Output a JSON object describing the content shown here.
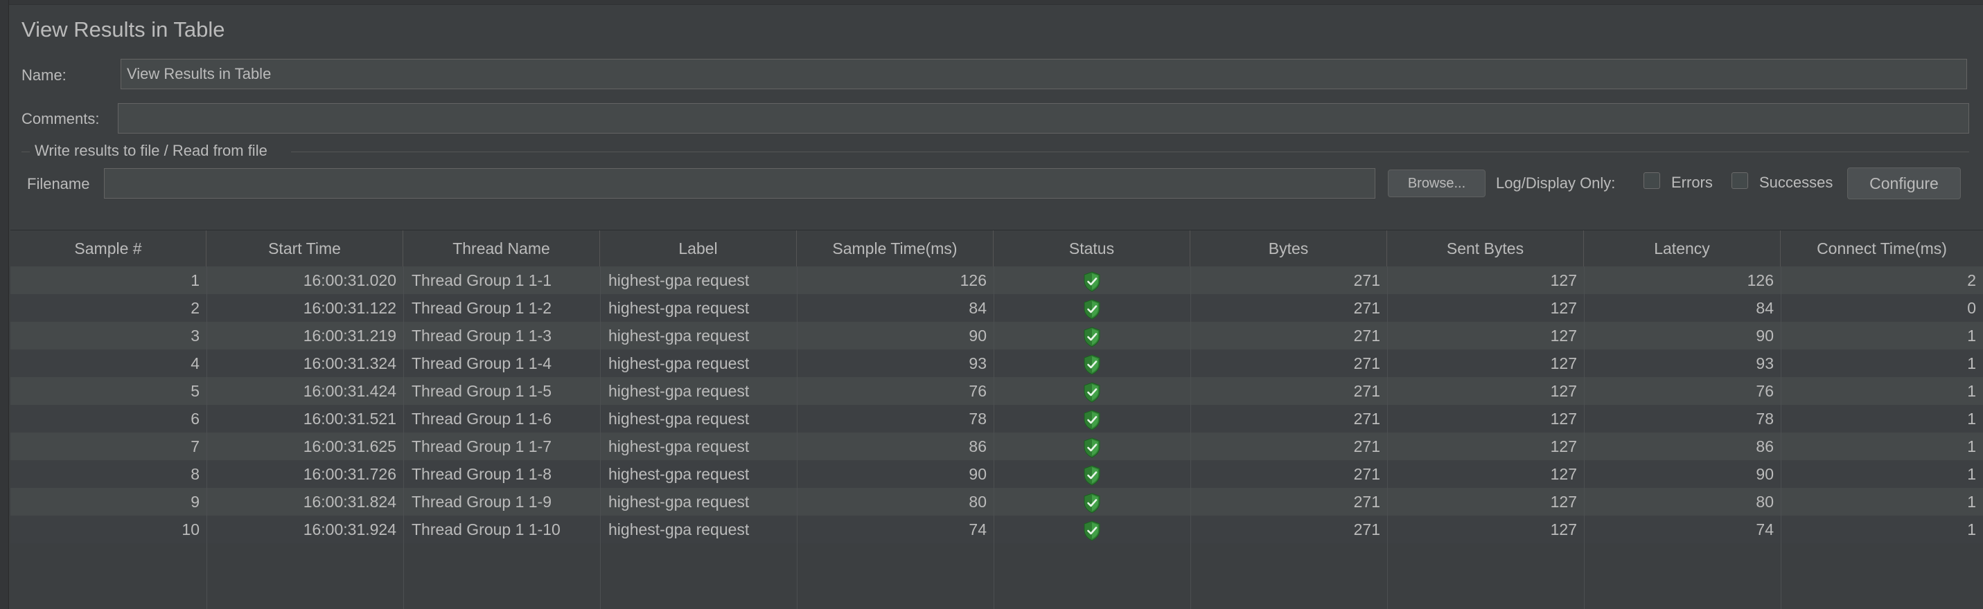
{
  "window": {
    "title": "View Results in Table"
  },
  "form": {
    "name_label": "Name:",
    "name_value": "View Results in Table",
    "comments_label": "Comments:",
    "comments_value": "",
    "file_group_title": "Write results to file / Read from file",
    "filename_label": "Filename",
    "filename_value": "",
    "browse_label": "Browse...",
    "log_display_label": "Log/Display Only:",
    "errors_label": "Errors",
    "errors_checked": false,
    "successes_label": "Successes",
    "successes_checked": false,
    "configure_label": "Configure"
  },
  "table": {
    "columns": [
      "Sample #",
      "Start Time",
      "Thread Name",
      "Label",
      "Sample Time(ms)",
      "Status",
      "Bytes",
      "Sent Bytes",
      "Latency",
      "Connect Time(ms)"
    ],
    "rows": [
      {
        "sample": "1",
        "start": "16:00:31.020",
        "thread": "Thread Group 1 1-1",
        "label": "highest-gpa request",
        "sample_time": "126",
        "status": "success-shield-icon",
        "bytes": "271",
        "sent": "127",
        "latency": "126",
        "connect": "2"
      },
      {
        "sample": "2",
        "start": "16:00:31.122",
        "thread": "Thread Group 1 1-2",
        "label": "highest-gpa request",
        "sample_time": "84",
        "status": "success-shield-icon",
        "bytes": "271",
        "sent": "127",
        "latency": "84",
        "connect": "0"
      },
      {
        "sample": "3",
        "start": "16:00:31.219",
        "thread": "Thread Group 1 1-3",
        "label": "highest-gpa request",
        "sample_time": "90",
        "status": "success-shield-icon",
        "bytes": "271",
        "sent": "127",
        "latency": "90",
        "connect": "1"
      },
      {
        "sample": "4",
        "start": "16:00:31.324",
        "thread": "Thread Group 1 1-4",
        "label": "highest-gpa request",
        "sample_time": "93",
        "status": "success-shield-icon",
        "bytes": "271",
        "sent": "127",
        "latency": "93",
        "connect": "1"
      },
      {
        "sample": "5",
        "start": "16:00:31.424",
        "thread": "Thread Group 1 1-5",
        "label": "highest-gpa request",
        "sample_time": "76",
        "status": "success-shield-icon",
        "bytes": "271",
        "sent": "127",
        "latency": "76",
        "connect": "1"
      },
      {
        "sample": "6",
        "start": "16:00:31.521",
        "thread": "Thread Group 1 1-6",
        "label": "highest-gpa request",
        "sample_time": "78",
        "status": "success-shield-icon",
        "bytes": "271",
        "sent": "127",
        "latency": "78",
        "connect": "1"
      },
      {
        "sample": "7",
        "start": "16:00:31.625",
        "thread": "Thread Group 1 1-7",
        "label": "highest-gpa request",
        "sample_time": "86",
        "status": "success-shield-icon",
        "bytes": "271",
        "sent": "127",
        "latency": "86",
        "connect": "1"
      },
      {
        "sample": "8",
        "start": "16:00:31.726",
        "thread": "Thread Group 1 1-8",
        "label": "highest-gpa request",
        "sample_time": "90",
        "status": "success-shield-icon",
        "bytes": "271",
        "sent": "127",
        "latency": "90",
        "connect": "1"
      },
      {
        "sample": "9",
        "start": "16:00:31.824",
        "thread": "Thread Group 1 1-9",
        "label": "highest-gpa request",
        "sample_time": "80",
        "status": "success-shield-icon",
        "bytes": "271",
        "sent": "127",
        "latency": "80",
        "connect": "1"
      },
      {
        "sample": "10",
        "start": "16:00:31.924",
        "thread": "Thread Group 1 1-10",
        "label": "highest-gpa request",
        "sample_time": "74",
        "status": "success-shield-icon",
        "bytes": "271",
        "sent": "127",
        "latency": "74",
        "connect": "1"
      }
    ]
  },
  "colors": {
    "background": "#3c3f41",
    "text": "#bbbbbb",
    "success": "#4caf50"
  }
}
